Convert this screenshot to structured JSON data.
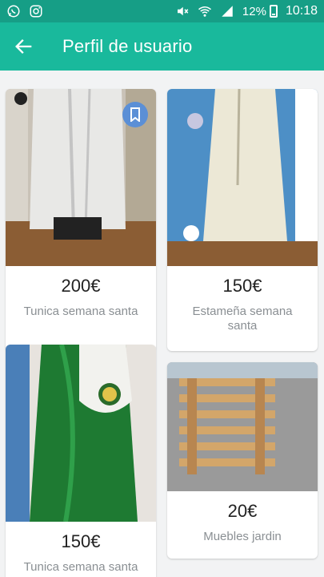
{
  "status_bar": {
    "battery": "12%",
    "time": "10:18",
    "icons": [
      "whatsapp-icon",
      "instagram-icon",
      "mute-icon",
      "wifi-icon",
      "signal-icon",
      "battery-icon"
    ]
  },
  "app_bar": {
    "title": "Perfil de usuario",
    "back_icon": "arrow-left-icon"
  },
  "products": [
    {
      "price": "200€",
      "title": "Tunica semana santa",
      "bookmarked": true
    },
    {
      "price": "150€",
      "title": "Estameña semana santa"
    },
    {
      "price": "150€",
      "title": "Tunica semana santa"
    },
    {
      "price": "20€",
      "title": "Muebles jardin"
    }
  ],
  "colors": {
    "status_bar": "#169e86",
    "app_bar": "#19b99c",
    "bookmark": "#5b8fd6"
  }
}
